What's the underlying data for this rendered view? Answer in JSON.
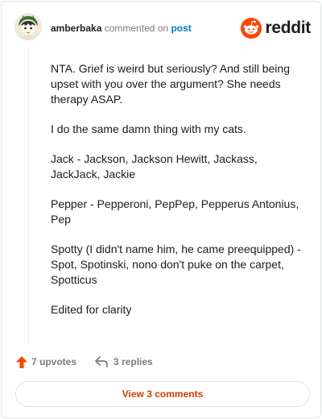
{
  "header": {
    "username": "amberbaka",
    "action_text": "commented on",
    "post_link": "post",
    "brand": "reddit",
    "brand_color": "#ff4500"
  },
  "comment": {
    "paragraphs": [
      "NTA. Grief is weird but seriously? And still being upset with you over the argument? She needs therapy ASAP.",
      "I do the same damn thing with my cats.",
      "Jack - Jackson, Jackson Hewitt, Jackass, JackJack, Jackie",
      "Pepper - Pepperoni, PepPep, Pepperus Antonius, Pep",
      "Spotty (I didn't name him, he came preequipped) - Spot, Spotinski, nono don't puke on the carpet, Spotticus",
      "Edited for clarity"
    ]
  },
  "footer": {
    "upvotes": "7 upvotes",
    "replies": "3 replies",
    "upvote_icon": "upvote-arrow-icon",
    "reply_icon": "reply-arrow-icon",
    "upvote_color": "#ff4500"
  },
  "view_comments": {
    "label": "View 3 comments",
    "color": "#d93a00"
  }
}
